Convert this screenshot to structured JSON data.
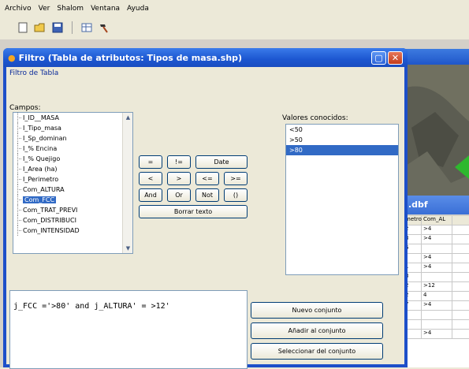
{
  "menubar": {
    "items": [
      "Archivo",
      "Ver",
      "Shalom",
      "Ventana",
      "Ayuda"
    ]
  },
  "toolbar": {
    "icons": [
      "new-file-icon",
      "open-folder-icon",
      "save-icon",
      "table-icon",
      "hammer-icon"
    ]
  },
  "dialog": {
    "title": "Filtro (Tabla de atributos: Tipos de masa.shp)",
    "tab_label": "Filtro de Tabla",
    "campos_label": "Campos:",
    "campos": [
      "I_ID__MASA",
      "I_Tipo_masa",
      "I_Sp_dominan",
      "I_% Encina",
      "I_% Quejigo",
      "I_Area (ha)",
      "I_Perimetro",
      "Com_ALTURA",
      "Com_FCC",
      "Com_TRAT_PREVI",
      "Com_DISTRIBUCI",
      "Com_INTENSIDAD"
    ],
    "selected_campo": "Com_FCC",
    "operators": {
      "eq": "=",
      "ne": "!=",
      "date": "Date",
      "lt": "<",
      "gt": ">",
      "le": "<=",
      "ge": ">=",
      "and": "And",
      "or": "Or",
      "not": "Not",
      "parens": "()",
      "clear": "Borrar texto"
    },
    "valores_label": "Valores conocidos:",
    "valores": [
      "<50",
      ">50",
      ">80"
    ],
    "selected_valor": ">80",
    "expression": "j_FCC ='>80' and j_ALTURA' = >12'",
    "buttons": {
      "nuevo": "Nuevo conjunto",
      "anadir": "Añadir al conjunto",
      "seleccionar": "Seleccionar del conjunto"
    }
  },
  "background_table": {
    "title": ".dbf",
    "headers": [
      "metro",
      "Com_AL"
    ],
    "rows": [
      [
        "2",
        ">4"
      ],
      [
        "8",
        ">4"
      ],
      [
        "6",
        ""
      ],
      [
        "",
        ">4"
      ],
      [
        "1",
        ">4"
      ],
      [
        "8",
        ""
      ],
      [
        "2",
        ">12"
      ],
      [
        "2",
        "4"
      ],
      [
        "7",
        ">4"
      ],
      [
        "",
        ""
      ],
      [
        "",
        ""
      ],
      [
        "",
        ">4"
      ]
    ]
  }
}
